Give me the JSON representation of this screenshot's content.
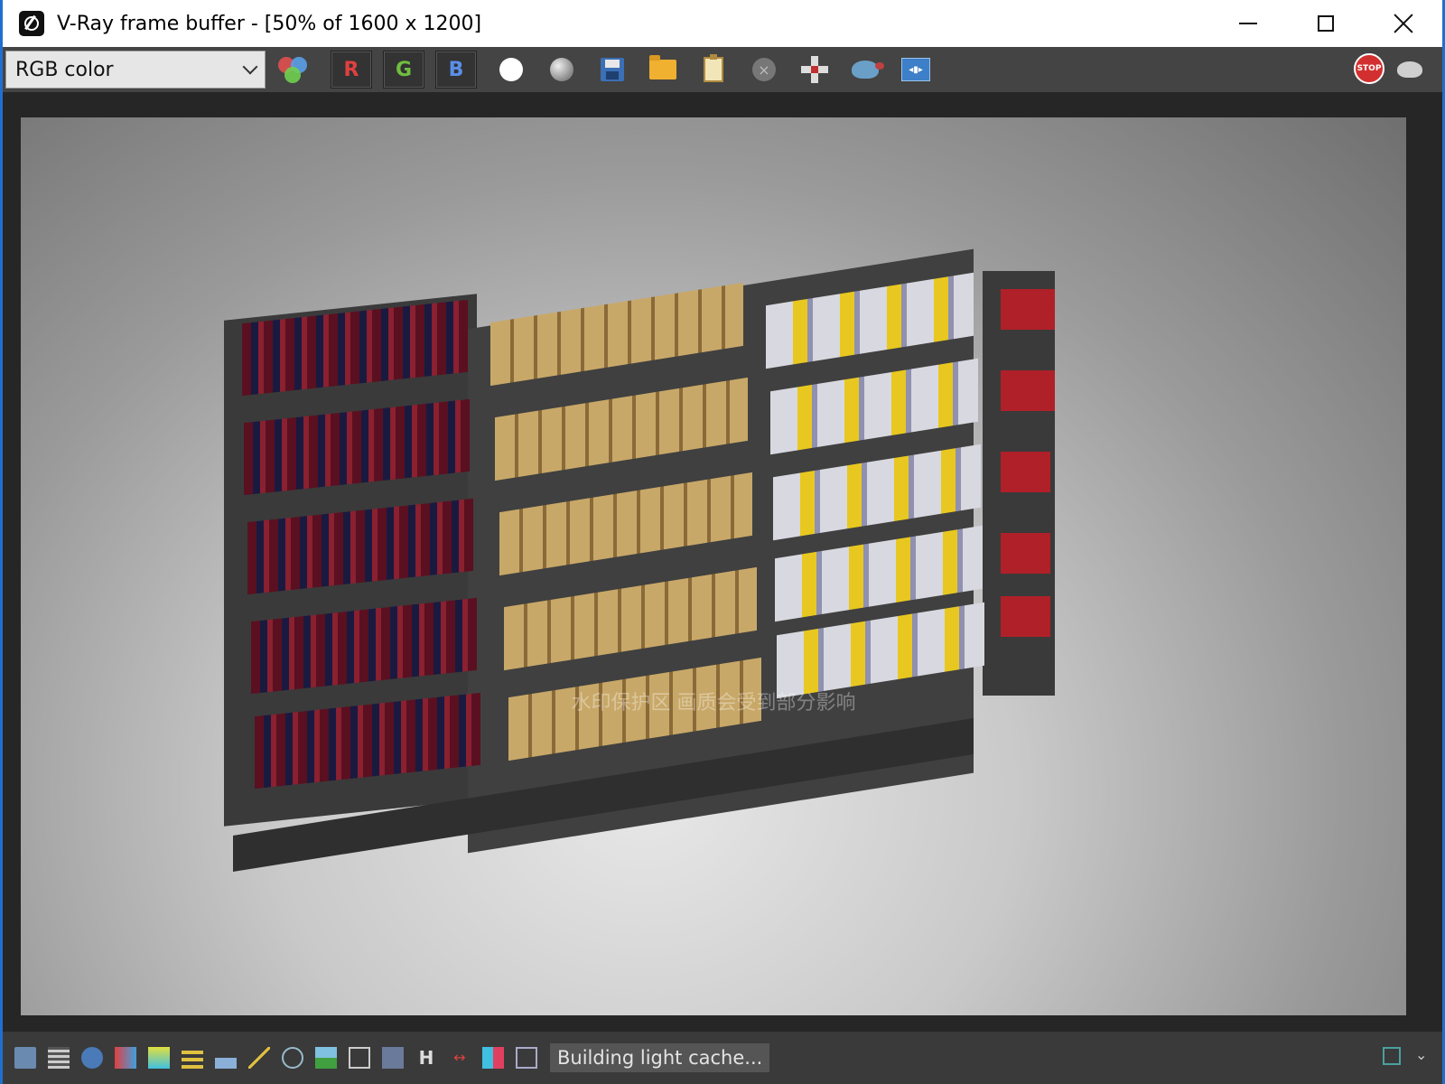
{
  "window": {
    "title": "V-Ray frame buffer - [50% of 1600 x 1200]"
  },
  "toolbar": {
    "channel_select": {
      "value": "RGB color"
    },
    "channel_buttons": [
      {
        "label": "R",
        "color": "#e04040"
      },
      {
        "label": "G",
        "color": "#6fbf3f"
      },
      {
        "label": "B",
        "color": "#5a8ee8"
      }
    ],
    "icons": [
      "white-point-icon",
      "gray-sphere-icon",
      "save-icon",
      "open-folder-icon",
      "clipboard-icon",
      "clear-icon",
      "region-render-icon",
      "teapot-render-icon",
      "compare-ab-icon"
    ],
    "stop_label": "STOP"
  },
  "watermark": "水印保护区 画质会受到部分影响",
  "status": {
    "message": "Building light cache..."
  },
  "colors": {
    "titlebar_bg": "#ffffff",
    "toolbar_bg": "#444444",
    "window_border": "#1f6fd0",
    "stop": "#d23030"
  }
}
